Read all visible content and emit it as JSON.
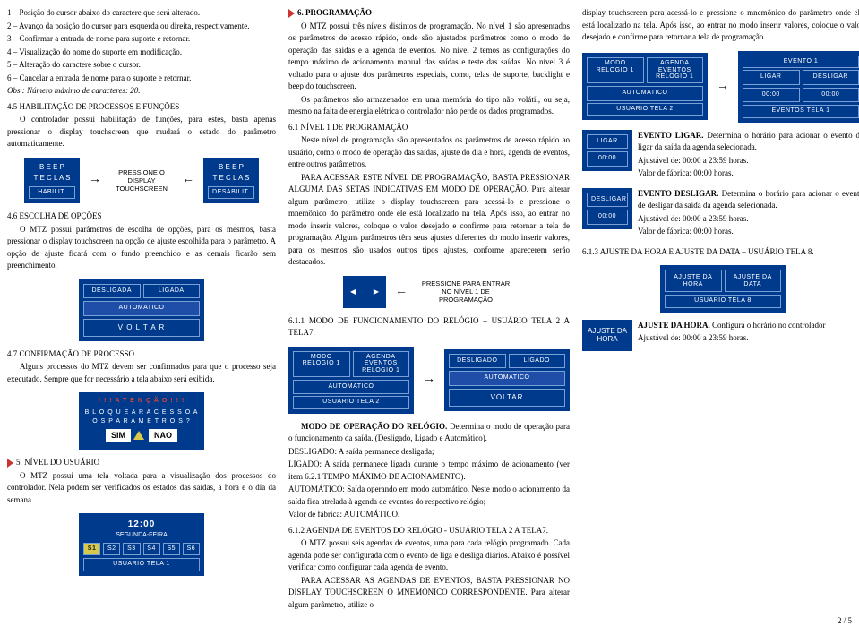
{
  "c1": {
    "l1": "1 – Posição do cursor abaixo do caractere que será alterado.",
    "l2": "2 – Avanço da posição do cursor para esquerda ou direita, respectivamente.",
    "l3": "3 – Confirmar a entrada de nome para suporte e retornar.",
    "l4": "4 – Visualização do nome do suporte em modificação.",
    "l5": "5 – Alteração do caractere sobre o cursor.",
    "l6": "6 – Cancelar a entrada de nome para o suporte e retornar.",
    "obs": "Obs.: Número máximo de caracteres: 20.",
    "s45": "4.5 HABILITAÇÃO DE PROCESSOS E FUNÇÕES",
    "s45t": "O controlador possui habilitação de funções, para estes, basta apenas pressionar o display touchscreen que mudará o estado do parâmetro automaticamente.",
    "beep": "B E E P",
    "teclas": "T E C L A S",
    "habilit": "HABILIT.",
    "desabilit": "DESABILIT.",
    "press_disp": "PRESSIONE O DISPLAY TOUCHSCREEN",
    "s46": "4.6 ESCOLHA DE OPÇÕES",
    "s46t": "O MTZ possui parâmetros de escolha de opções, para os mesmos, basta pressionar o display touchscreen na opção de ajuste escolhida para o parâmetro. A opção de ajuste ficará com o fundo preenchido e as demais ficarão sem preenchimento.",
    "desligada": "DESLIGADA",
    "ligada": "LIGADA",
    "automatico": "AUTOMATICO",
    "voltar": "V O L T A R",
    "s47": "4.7 CONFIRMAÇÃO DE PROCESSO",
    "s47t": "Alguns processos do MTZ devem ser confirmados para que o processo seja executado. Sempre que for necessário a tela abaixo será exibida.",
    "atencao": "! ! ! A T E N Ç Ã O ! ! !",
    "bloquear": "B L O Q U E A R  A C E S S O  A O S  P A R A M E T R O S ?",
    "sim": "SIM",
    "nao": "NAO",
    "s5": "5. NÍVEL DO USUÁRIO",
    "s5t": "O MTZ possui uma tela voltada para a visualização dos processos do controlador. Nela podem ser verificados os estados das saídas, a hora e o dia da semana.",
    "clock": "12:00",
    "dow": "SEGUNDA-FEIRA",
    "s1": "S1",
    "s2l": "S2",
    "s3": "S3",
    "s4": "S4",
    "s5l": "S5",
    "s6": "S6",
    "usuario1": "USUARIO TELA 1"
  },
  "c2": {
    "s6": "6. PROGRAMAÇÃO",
    "p1": "O MTZ possui três níveis distintos de programação. No nível 1 são apresentados os parâmetros de acesso rápido, onde são ajustados parâmetros como o modo de operação das saídas e a agenda de eventos. No nível 2 temos as configurações do tempo máximo de acionamento manual das saídas e teste das saídas. No nível 3 é voltado para o ajuste dos parâmetros especiais, como, telas de suporte, backlight e beep do touchscreen.",
    "p2": "Os parâmetros são armazenados em uma memória do tipo não volátil, ou seja, mesmo na falta de energia elétrica o controlador não perde os dados programados.",
    "s61": "6.1 NÍVEL 1 DE PROGRAMAÇÃO",
    "p3": "Neste nível de programação são apresentados os parâmetros de acesso rápido ao usuário, como o modo de operação das saídas, ajuste do dia e hora, agenda de eventos, entre outros parâmetros.",
    "p4": "PARA ACESSAR ESTE NÍVEL DE PROGRAMAÇÃO, BASTA PRESSIONAR ALGUMA DAS SETAS INDICATIVAS EM MODO DE OPERAÇÃO. Para alterar algum parâmetro, utilize o display touchscreen para acessá-lo e pressione o mnemônico do parâmetro onde ele está localizado na tela. Após isso, ao entrar no modo inserir valores, coloque o valor desejado e confirme para retornar a tela de programação. Alguns parâmetros têm seus ajustes diferentes do modo inserir valores, para os mesmos são usados outros tipos ajustes, conforme aparecerem serão destacados.",
    "press_enter": "PRESSIONE PARA ENTRAR NO NÍVEL 1 DE PROGRAMAÇÃO",
    "s611": "6.1.1 MODO DE FUNCIONAMENTO DO RELÓGIO – USUÁRIO TELA 2 A TELA7.",
    "modo_relogio": "MODO RELOGIO 1",
    "agenda_ev": "AGENDA EVENTOS RELOGIO 1",
    "automatico": "AUTOMATICO",
    "usuario2": "USUARIO TELA 2",
    "desligado": "DESLIGADO",
    "ligado": "LIGADO",
    "voltar": "VOLTAR",
    "modo_title": "MODO DE OPERAÇÃO DO RELÓGIO.",
    "modo_t": " Determina o modo de operação para o funcionamento da saída. (Desligado, Ligado e Automático).",
    "desl_t": "DESLIGADO: A saída permanece desligada;",
    "lig_t": "LIGADO: A saída permanece ligada durante o tempo máximo de acionamento (ver item 6.2.1 TEMPO MÁXIMO DE ACIONAMENTO).",
    "auto_t": "AUTOMÁTICO: Saída operando em modo automático. Neste modo o acionamento da saída fica atrelada à agenda de eventos do respectivo relógio;",
    "vf": "Valor de fábrica: AUTOMÁTICO.",
    "s612": "6.1.2 AGENDA DE EVENTOS DO RELÓGIO - USUÁRIO TELA 2 A TELA7.",
    "s612t1": "O MTZ possui seis agendas de eventos, uma para cada relógio programado. Cada agenda pode ser configurada com o evento de liga e desliga diários. Abaixo é possível verificar como configurar cada agenda de evento.",
    "s612t2": "PARA ACESSAR AS AGENDAS DE EVENTOS, BASTA PRESSIONAR NO DISPLAY TOUCHSCREEN O MNEMÔNICO CORRESPONDENTE. Para alterar algum parâmetro, utilize o"
  },
  "c3": {
    "p1": "display touchscreen para acessá-lo e pressione o mnemônico do parâmetro onde ele está localizado na tela. Após isso, ao entrar no modo inserir valores, coloque o valor desejado e confirme para retornar a tela de programação.",
    "modo_relogio": "MODO RELOGIO 1",
    "agenda_ev": "AGENDA EVENTOS RELOGIO 1",
    "automatico": "AUTOMATICO",
    "usuario2": "USUARIO TELA 2",
    "evento1": "EVENTO 1",
    "ligar": "LIGAR",
    "desligar": "DESLIGAR",
    "t0": "00:00",
    "eventos1": "EVENTOS TELA 1",
    "ev_lig_h": "EVENTO LIGAR.",
    "ev_lig_t": " Determina o horário para acionar o evento de ligar da saída da agenda selecionada.",
    "aj": "Ajustável de: 00:00 a 23:59 horas.",
    "vf": "Valor de fábrica: 00:00 horas.",
    "ev_des_h": "EVENTO DESLIGAR.",
    "ev_des_t": " Determina o horário para acionar o evento de desligar da saída da agenda selecionada.",
    "s613": "6.1.3 AJUSTE DA HORA E AJUSTE DA DATA – USUÁRIO TELA 8.",
    "aj_hora": "AJUSTE DA HORA",
    "aj_data": "AJUSTE DA DATA",
    "usuario8": "USUARIO TELA 8",
    "aj_h_title": "AJUSTE DA HORA.",
    "aj_h_t": " Configura o horário no controlador",
    "aj2": "Ajustável de: 00:00 a 23:59 horas."
  },
  "footer": "2 / 5"
}
